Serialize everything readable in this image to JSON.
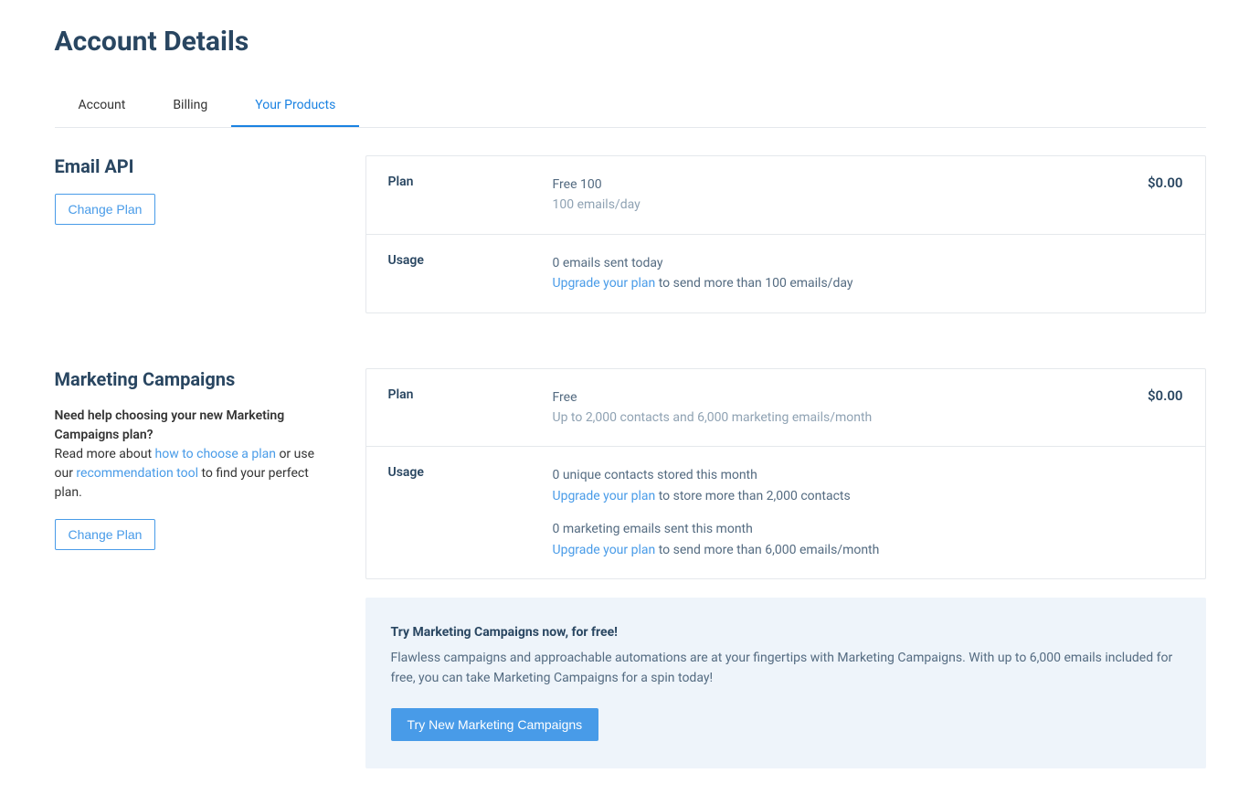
{
  "page_title": "Account Details",
  "tabs": [
    {
      "label": "Account",
      "active": false
    },
    {
      "label": "Billing",
      "active": false
    },
    {
      "label": "Your Products",
      "active": true
    }
  ],
  "email_api": {
    "title": "Email API",
    "change_plan_btn": "Change Plan",
    "plan_label": "Plan",
    "plan_name": "Free 100",
    "plan_sub": "100 emails/day",
    "plan_price": "$0.00",
    "usage_label": "Usage",
    "usage_line": "0 emails sent today",
    "upgrade_link": "Upgrade your plan",
    "upgrade_rest": " to send more than 100 emails/day"
  },
  "marketing": {
    "title": "Marketing Campaigns",
    "help_strong": "Need help choosing your new Marketing Campaigns plan?",
    "help_before_link1": "Read more about ",
    "help_link1": "how to choose a plan",
    "help_between": " or use our ",
    "help_link2": "recommendation tool",
    "help_after": " to find your perfect plan.",
    "change_plan_btn": "Change Plan",
    "plan_label": "Plan",
    "plan_name": "Free",
    "plan_sub": "Up to 2,000 contacts and 6,000 marketing emails/month",
    "plan_price": "$0.00",
    "usage_label": "Usage",
    "usage1_line": "0 unique contacts stored this month",
    "usage1_upgrade_link": "Upgrade your plan",
    "usage1_upgrade_rest": " to store more than 2,000 contacts",
    "usage2_line": "0 marketing emails sent this month",
    "usage2_upgrade_link": "Upgrade your plan",
    "usage2_upgrade_rest": " to send more than 6,000 emails/month"
  },
  "promo": {
    "title": "Try Marketing Campaigns now, for free!",
    "desc": "Flawless campaigns and approachable automations are at your fingertips with Marketing Campaigns. With up to 6,000 emails included for free, you can take Marketing Campaigns for a spin today!",
    "btn": "Try New Marketing Campaigns"
  }
}
